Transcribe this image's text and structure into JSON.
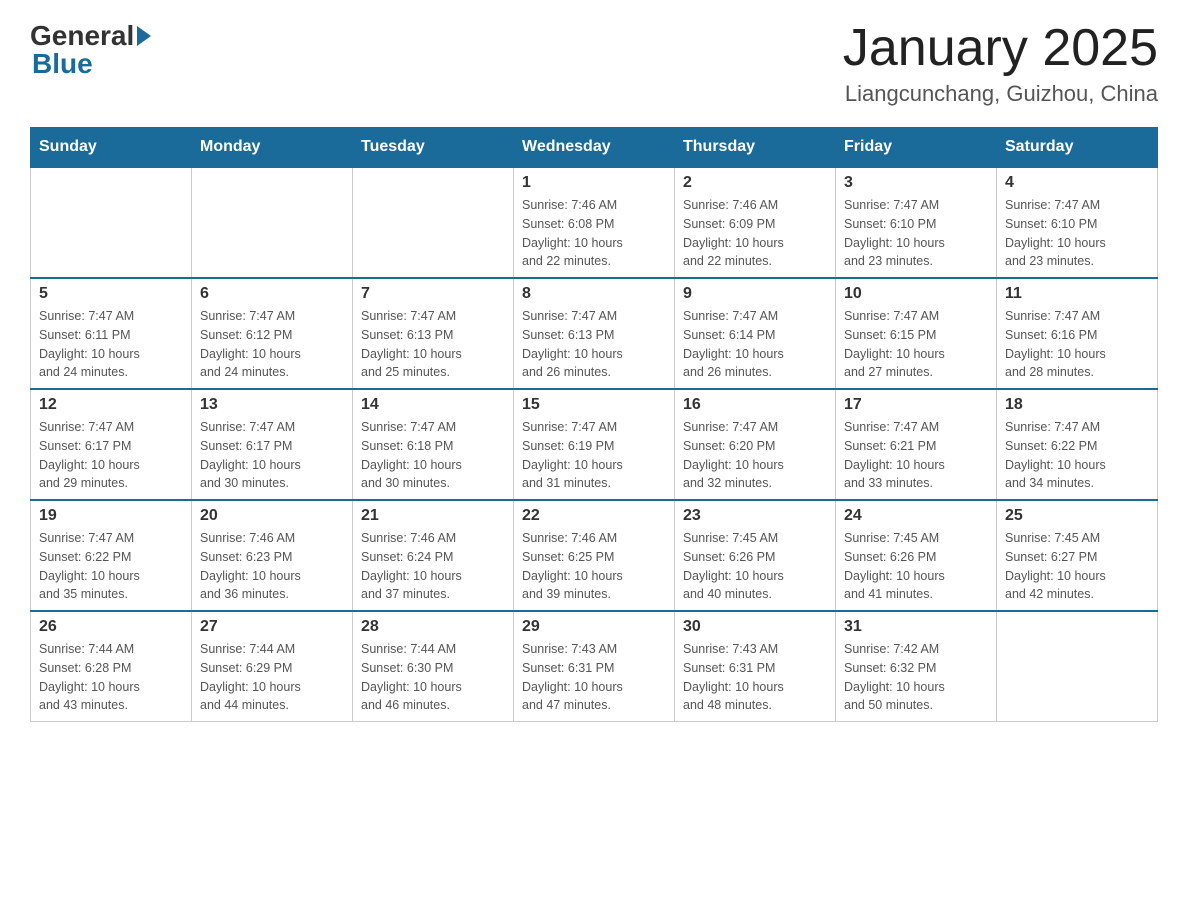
{
  "header": {
    "logo_general": "General",
    "logo_blue": "Blue",
    "month_year": "January 2025",
    "location": "Liangcunchang, Guizhou, China"
  },
  "days_of_week": [
    "Sunday",
    "Monday",
    "Tuesday",
    "Wednesday",
    "Thursday",
    "Friday",
    "Saturday"
  ],
  "weeks": [
    [
      null,
      null,
      null,
      {
        "day": "1",
        "sunrise": "7:46 AM",
        "sunset": "6:08 PM",
        "daylight": "10 hours and 22 minutes."
      },
      {
        "day": "2",
        "sunrise": "7:46 AM",
        "sunset": "6:09 PM",
        "daylight": "10 hours and 22 minutes."
      },
      {
        "day": "3",
        "sunrise": "7:47 AM",
        "sunset": "6:10 PM",
        "daylight": "10 hours and 23 minutes."
      },
      {
        "day": "4",
        "sunrise": "7:47 AM",
        "sunset": "6:10 PM",
        "daylight": "10 hours and 23 minutes."
      }
    ],
    [
      {
        "day": "5",
        "sunrise": "7:47 AM",
        "sunset": "6:11 PM",
        "daylight": "10 hours and 24 minutes."
      },
      {
        "day": "6",
        "sunrise": "7:47 AM",
        "sunset": "6:12 PM",
        "daylight": "10 hours and 24 minutes."
      },
      {
        "day": "7",
        "sunrise": "7:47 AM",
        "sunset": "6:13 PM",
        "daylight": "10 hours and 25 minutes."
      },
      {
        "day": "8",
        "sunrise": "7:47 AM",
        "sunset": "6:13 PM",
        "daylight": "10 hours and 26 minutes."
      },
      {
        "day": "9",
        "sunrise": "7:47 AM",
        "sunset": "6:14 PM",
        "daylight": "10 hours and 26 minutes."
      },
      {
        "day": "10",
        "sunrise": "7:47 AM",
        "sunset": "6:15 PM",
        "daylight": "10 hours and 27 minutes."
      },
      {
        "day": "11",
        "sunrise": "7:47 AM",
        "sunset": "6:16 PM",
        "daylight": "10 hours and 28 minutes."
      }
    ],
    [
      {
        "day": "12",
        "sunrise": "7:47 AM",
        "sunset": "6:17 PM",
        "daylight": "10 hours and 29 minutes."
      },
      {
        "day": "13",
        "sunrise": "7:47 AM",
        "sunset": "6:17 PM",
        "daylight": "10 hours and 30 minutes."
      },
      {
        "day": "14",
        "sunrise": "7:47 AM",
        "sunset": "6:18 PM",
        "daylight": "10 hours and 30 minutes."
      },
      {
        "day": "15",
        "sunrise": "7:47 AM",
        "sunset": "6:19 PM",
        "daylight": "10 hours and 31 minutes."
      },
      {
        "day": "16",
        "sunrise": "7:47 AM",
        "sunset": "6:20 PM",
        "daylight": "10 hours and 32 minutes."
      },
      {
        "day": "17",
        "sunrise": "7:47 AM",
        "sunset": "6:21 PM",
        "daylight": "10 hours and 33 minutes."
      },
      {
        "day": "18",
        "sunrise": "7:47 AM",
        "sunset": "6:22 PM",
        "daylight": "10 hours and 34 minutes."
      }
    ],
    [
      {
        "day": "19",
        "sunrise": "7:47 AM",
        "sunset": "6:22 PM",
        "daylight": "10 hours and 35 minutes."
      },
      {
        "day": "20",
        "sunrise": "7:46 AM",
        "sunset": "6:23 PM",
        "daylight": "10 hours and 36 minutes."
      },
      {
        "day": "21",
        "sunrise": "7:46 AM",
        "sunset": "6:24 PM",
        "daylight": "10 hours and 37 minutes."
      },
      {
        "day": "22",
        "sunrise": "7:46 AM",
        "sunset": "6:25 PM",
        "daylight": "10 hours and 39 minutes."
      },
      {
        "day": "23",
        "sunrise": "7:45 AM",
        "sunset": "6:26 PM",
        "daylight": "10 hours and 40 minutes."
      },
      {
        "day": "24",
        "sunrise": "7:45 AM",
        "sunset": "6:26 PM",
        "daylight": "10 hours and 41 minutes."
      },
      {
        "day": "25",
        "sunrise": "7:45 AM",
        "sunset": "6:27 PM",
        "daylight": "10 hours and 42 minutes."
      }
    ],
    [
      {
        "day": "26",
        "sunrise": "7:44 AM",
        "sunset": "6:28 PM",
        "daylight": "10 hours and 43 minutes."
      },
      {
        "day": "27",
        "sunrise": "7:44 AM",
        "sunset": "6:29 PM",
        "daylight": "10 hours and 44 minutes."
      },
      {
        "day": "28",
        "sunrise": "7:44 AM",
        "sunset": "6:30 PM",
        "daylight": "10 hours and 46 minutes."
      },
      {
        "day": "29",
        "sunrise": "7:43 AM",
        "sunset": "6:31 PM",
        "daylight": "10 hours and 47 minutes."
      },
      {
        "day": "30",
        "sunrise": "7:43 AM",
        "sunset": "6:31 PM",
        "daylight": "10 hours and 48 minutes."
      },
      {
        "day": "31",
        "sunrise": "7:42 AM",
        "sunset": "6:32 PM",
        "daylight": "10 hours and 50 minutes."
      },
      null
    ]
  ],
  "labels": {
    "sunrise_prefix": "Sunrise: ",
    "sunset_prefix": "Sunset: ",
    "daylight_prefix": "Daylight: "
  }
}
